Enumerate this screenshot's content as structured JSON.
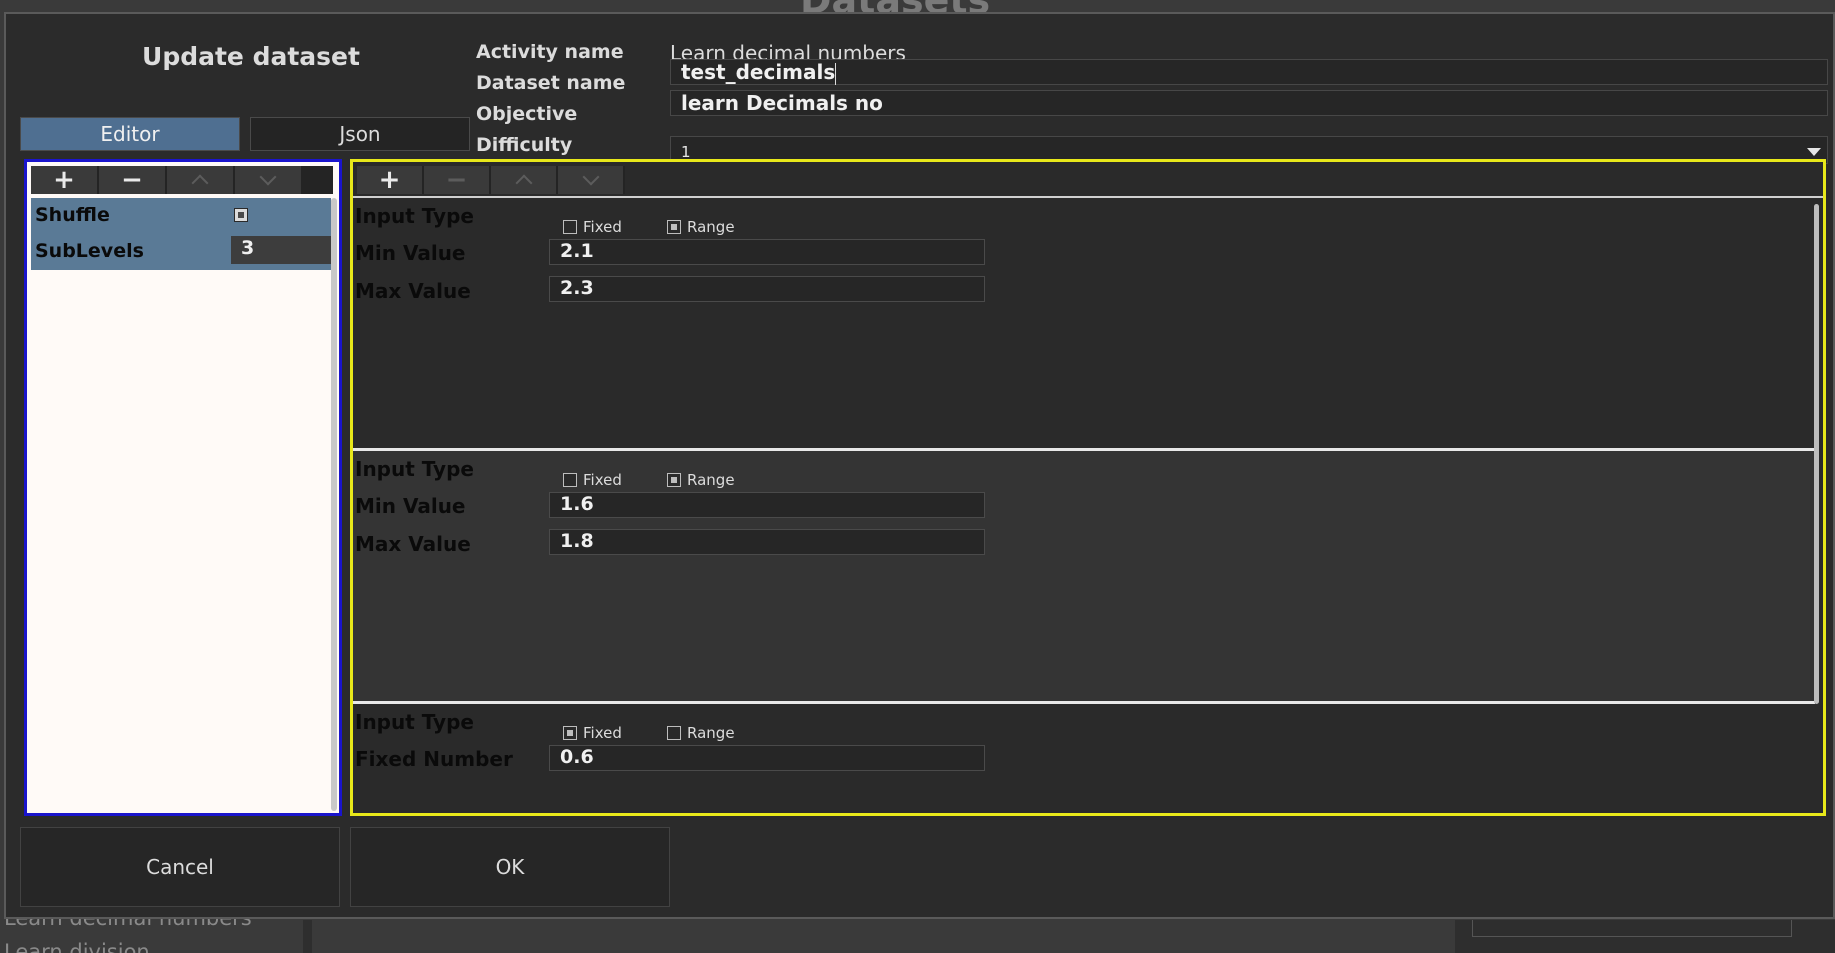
{
  "background": {
    "title": "Datasets",
    "bottom_text": "Learn decimal numbers",
    "bottom_text2": "Learn division"
  },
  "dialog": {
    "title": "Update dataset",
    "tabs": [
      {
        "label": "Editor",
        "active": true
      },
      {
        "label": "Json",
        "active": false
      }
    ],
    "fields": {
      "activity_label": "Activity name",
      "activity_value": "Learn decimal numbers",
      "dataset_label": "Dataset name",
      "dataset_value": "test_decimals",
      "objective_label": "Objective",
      "objective_value": "learn Decimals no",
      "difficulty_label": "Difficulty",
      "difficulty_value": "1"
    },
    "left_toolbar": {
      "add": "+",
      "remove": "−"
    },
    "left_list": [
      {
        "label": "Shuffle",
        "type": "checkbox",
        "checked": true
      },
      {
        "label": "SubLevels",
        "type": "number",
        "value": "3"
      }
    ],
    "right_toolbar": {
      "add": "+",
      "remove": "−"
    },
    "records": [
      {
        "input_type_label": "Input Type",
        "fixed_label": "Fixed",
        "range_label": "Range",
        "mode": "range",
        "min_label": "Min Value",
        "min_value": "2.1",
        "max_label": "Max Value",
        "max_value": "2.3"
      },
      {
        "input_type_label": "Input Type",
        "fixed_label": "Fixed",
        "range_label": "Range",
        "mode": "range",
        "min_label": "Min Value",
        "min_value": "1.6",
        "max_label": "Max Value",
        "max_value": "1.8"
      },
      {
        "input_type_label": "Input Type",
        "fixed_label": "Fixed",
        "range_label": "Range",
        "mode": "fixed",
        "fixed_number_label": "Fixed Number",
        "fixed_number_value": "0.6"
      }
    ],
    "buttons": {
      "cancel": "Cancel",
      "ok": "OK"
    }
  },
  "colors": {
    "accent_tab": "#4f6f91",
    "left_panel_border": "#1a14cc",
    "right_panel_border": "#e8e81a"
  }
}
